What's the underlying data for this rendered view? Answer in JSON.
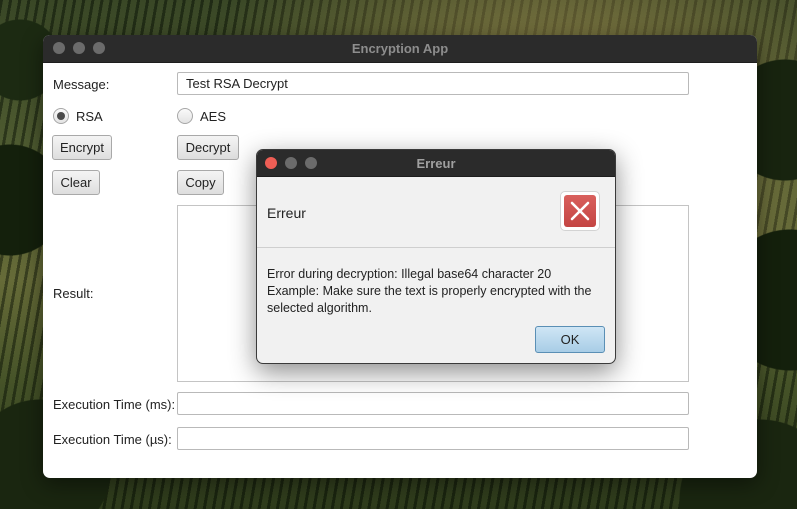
{
  "window": {
    "title": "Encryption App",
    "message_label": "Message:",
    "message_value": "Test RSA Decrypt",
    "radio_rsa": "RSA",
    "radio_aes": "AES",
    "selected_algorithm": "RSA",
    "buttons": {
      "encrypt": "Encrypt",
      "decrypt": "Decrypt",
      "clear": "Clear",
      "copy": "Copy"
    },
    "result_label": "Result:",
    "result_value": "",
    "exec_ms_label": "Execution Time (ms):",
    "exec_ms_value": "",
    "exec_us_label": "Execution Time (µs):",
    "exec_us_value": ""
  },
  "dialog": {
    "title": "Erreur",
    "header": "Erreur",
    "icon": "error-x-icon",
    "message_line1": "Error during decryption: Illegal base64 character 20",
    "message_line2": "Example: Make sure the text is properly encrypted with the",
    "message_line3": "selected algorithm.",
    "ok_label": "OK"
  },
  "colors": {
    "titlebar": "#2b2b2b",
    "close_red": "#ee5e55",
    "inactive_gray": "#6b6b6b",
    "error_red": "#c9504d",
    "default_button": "#b7d8ee"
  }
}
